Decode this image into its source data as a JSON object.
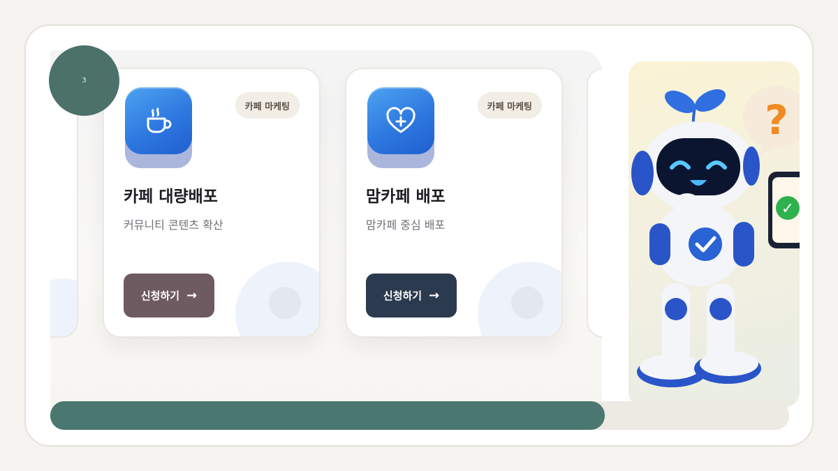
{
  "step": {
    "number": "3"
  },
  "cards": [
    {
      "tag": "카페 마케팅",
      "title": "카페 대량배포",
      "description": "커뮤니티 콘텐츠 확산",
      "button": "신청하기",
      "button_arrow": "→",
      "button_color": "#6e5a61",
      "icon": "coffee-cup-icon"
    },
    {
      "tag": "카페 마케팅",
      "title": "맘카페 배포",
      "description": "맘카페 중심 배포",
      "button": "신청하기",
      "button_arrow": "→",
      "button_color": "#2c3a4f",
      "icon": "heart-plus-icon"
    }
  ],
  "progress": {
    "fraction": 0.75,
    "fill_color": "#4a776f"
  },
  "illustration": {
    "name": "robot-mascot",
    "bubble_symbol": "?",
    "phone_symbol": "✓"
  }
}
